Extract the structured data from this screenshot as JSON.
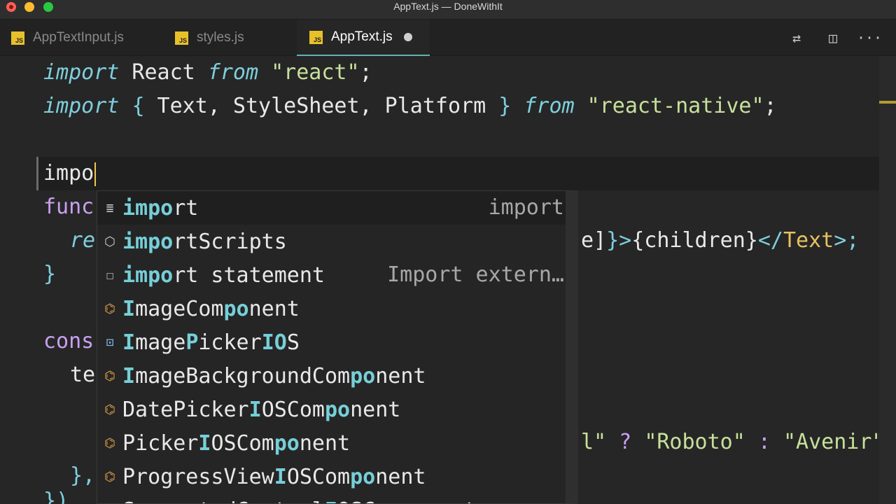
{
  "window": {
    "title": "AppText.js — DoneWithIt"
  },
  "tabs": [
    {
      "label": "AppTextInput.js",
      "badge": "JS"
    },
    {
      "label": "styles.js",
      "badge": "JS"
    },
    {
      "label": "AppText.js",
      "badge": "JS"
    }
  ],
  "tab_actions": [
    {
      "icon": "source-control-compare-icon",
      "glyph": "⇄"
    },
    {
      "icon": "split-editor-icon",
      "glyph": "◫"
    },
    {
      "icon": "more-actions-icon",
      "glyph": "···"
    }
  ],
  "code": {
    "line1": {
      "kw1": "import",
      "name": " React ",
      "kw2": "from",
      "sp": " ",
      "str": "\"react\"",
      "end": ";"
    },
    "line2": {
      "kw1": "import",
      "sp1": " ",
      "open": "{",
      "names": " Text, StyleSheet, Platform ",
      "close": "}",
      "sp2": " ",
      "kw2": "from",
      "sp3": " ",
      "str": "\"react-native\"",
      "end": ";"
    },
    "line4": {
      "typed": "impo"
    },
    "line5": {
      "text": "func"
    },
    "line6": {
      "text": "re",
      "tail_a": "e]",
      "tail_b": "}>",
      "tail_c": "{children}",
      "tail_d": "</",
      "tail_e": "Text",
      "tail_f": ">;"
    },
    "line7": {
      "text": "}"
    },
    "line9": {
      "text": "cons"
    },
    "line10": {
      "text": "te"
    },
    "line12": {
      "t1": "l\"",
      "t2": " ? ",
      "t3": "\"Roboto\"",
      "t4": " : ",
      "t5": "\"Avenir\""
    },
    "line13": {
      "text": "},"
    },
    "line14": {
      "text": "})"
    }
  },
  "suggestions": [
    {
      "icon": "snippet-keyword-icon",
      "glyph": "≣",
      "pre": "",
      "hl": "impo",
      "post": "rt",
      "detail": "import",
      "selected": true
    },
    {
      "icon": "module-icon",
      "glyph": "⬡",
      "pre": "",
      "hl": "impo",
      "post": "rtScripts",
      "detail": ""
    },
    {
      "icon": "snippet-icon",
      "glyph": "☐",
      "pre": "",
      "hl": "impo",
      "post": "rt statement",
      "detail": "Import extern…"
    },
    {
      "icon": "class-icon",
      "glyph": "⌬",
      "pre": "",
      "hl": "I",
      "mid": "mageCom",
      "hl2": "po",
      "post": "nent",
      "detail": ""
    },
    {
      "icon": "variable-icon",
      "glyph": "⊡",
      "pre": "",
      "hl": "I",
      "mid": "mage",
      "hl2": "P",
      "mid2": "icker",
      "hl3": "IO",
      "post": "S",
      "detail": ""
    },
    {
      "icon": "class-icon",
      "glyph": "⌬",
      "pre": "",
      "hl": "I",
      "mid": "mageBackgroundCom",
      "hl2": "po",
      "post": "nent",
      "detail": ""
    },
    {
      "icon": "class-icon",
      "glyph": "⌬",
      "pre": "DatePicker",
      "hl": "I",
      "mid": "OSCom",
      "hl2": "po",
      "post": "nent",
      "detail": ""
    },
    {
      "icon": "class-icon",
      "glyph": "⌬",
      "pre": "Picker",
      "hl": "I",
      "mid": "OSCom",
      "hl2": "po",
      "post": "nent",
      "detail": ""
    },
    {
      "icon": "class-icon",
      "glyph": "⌬",
      "pre": "ProgressView",
      "hl": "I",
      "mid": "OSCom",
      "hl2": "po",
      "post": "nent",
      "detail": ""
    },
    {
      "icon": "class-icon",
      "glyph": "⌬",
      "pre": "SegmentedControl",
      "hl": "I",
      "mid": "OSCom",
      "hl2": "po",
      "post": "nent",
      "detail": ""
    }
  ],
  "colors": {
    "accent": "#5fb3b3",
    "keyword": "#7ecfdd",
    "string": "#c7e09b",
    "caret": "#f4c54a",
    "match": "#76cfd8"
  }
}
